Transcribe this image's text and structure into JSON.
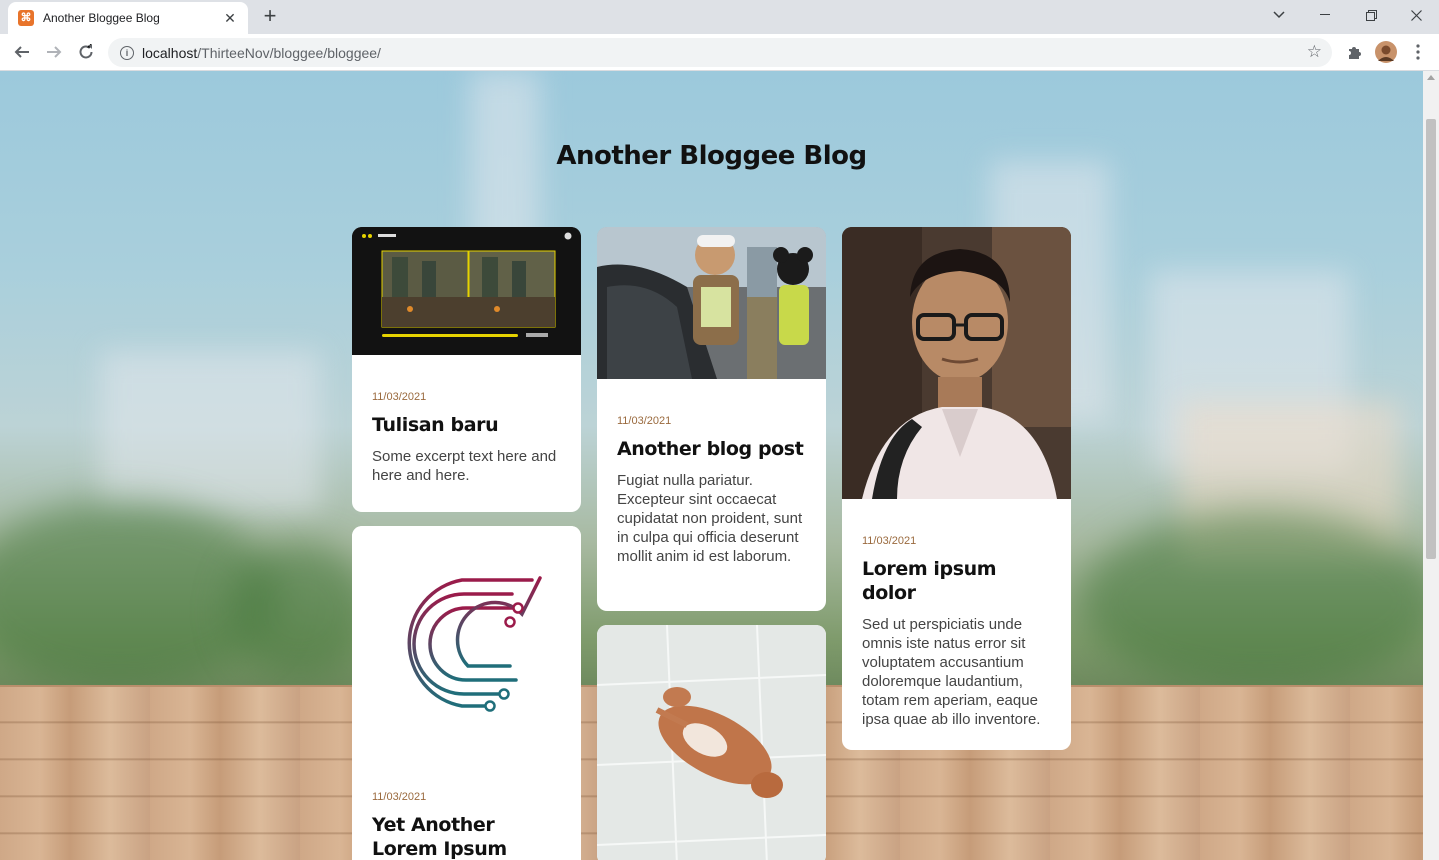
{
  "browser": {
    "tab_title": "Another Bloggee Blog",
    "url_host": "localhost",
    "url_path": "/ThirteeNov/bloggee/bloggee/"
  },
  "page": {
    "title": "Another Bloggee Blog"
  },
  "posts": [
    {
      "date": "11/03/2021",
      "title": "Tulisan baru",
      "excerpt": "Some excerpt text here and here and here.",
      "image": "game-screenshot"
    },
    {
      "date": "11/03/2021",
      "title": "Another blog post",
      "excerpt": "Fugiat nulla pariatur. Excepteur sint occaecat cupidatat non proident, sunt in culpa qui officia deserunt mollit anim id est laborum.",
      "image": "mascots-street-photo"
    },
    {
      "date": "11/03/2021",
      "title": "Lorem ipsum dolor",
      "excerpt": "Sed ut perspiciatis unde omnis iste natus error sit voluptatem accusantium doloremque laudantium, totam rem aperiam, eaque ipsa quae ab illo inventore.",
      "image": "portrait-photo"
    },
    {
      "date": "11/03/2021",
      "title": "Yet Another Lorem Ipsum Dolor",
      "excerpt": "",
      "image": "circuit-c-logo"
    },
    {
      "date": "",
      "title": "",
      "excerpt": "",
      "image": "sleeping-dog-photo"
    }
  ],
  "colors": {
    "date": "#9a6a3e",
    "accent_gradient": [
      "#9b1b4a",
      "#1f6e7a"
    ]
  }
}
